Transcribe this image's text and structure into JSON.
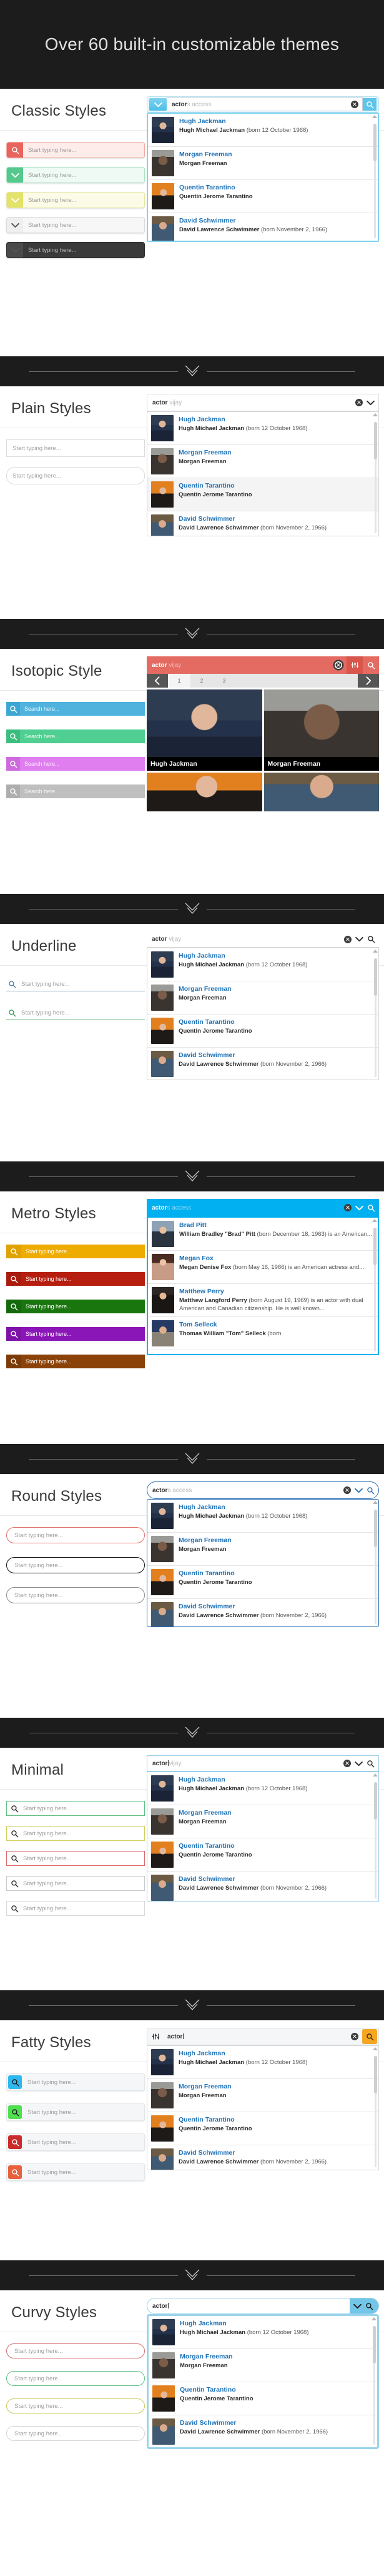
{
  "hero": {
    "title": "Over 60 built-in customizable themes"
  },
  "icons": {
    "clear": "clear-circle-icon",
    "search": "magnifier-icon",
    "chevron": "chevron-down-icon",
    "sliders": "sliders-icon",
    "prev": "chevron-left-icon",
    "next": "chevron-right-icon",
    "scroll_up": "scroll-up-arrow-icon"
  },
  "people": [
    {
      "name": "Hugh Jackman",
      "strong": "Hugh Michael Jackman",
      "rest": " (born 12 October 1968)"
    },
    {
      "name": "Morgan Freeman",
      "strong": "Morgan Freeman",
      "rest": ""
    },
    {
      "name": "Quentin Tarantino",
      "strong": "Quentin Jerome Tarantino",
      "rest": ""
    },
    {
      "name": "David Schwimmer",
      "strong": "David Lawrence Schwimmer",
      "rest": " (born November 2, 1966)"
    }
  ],
  "metro_people": [
    {
      "name": "Brad Pitt",
      "strong": "William Bradley \"Brad\" Pitt",
      "rest": " (born December 18, 1963) is an American..."
    },
    {
      "name": "Megan Fox",
      "strong": "Megan Denise Fox",
      "rest": " (born May 16, 1986) is an American actress and..."
    },
    {
      "name": "Matthew Perry",
      "strong": "Matthew Langford Perry",
      "rest": " (born August 19, 1969) is an actor with dual American and Canadian citizenship. He is well known..."
    },
    {
      "name": "Tom Selleck",
      "strong": "Thomas William \"Tom\" Selleck",
      "rest": " (born"
    }
  ],
  "sections": [
    {
      "id": "classic",
      "title": "Classic Styles",
      "query_typed": "actor",
      "query_ghost": "s access",
      "fields": [
        {
          "placeholder": "Start typing here...",
          "color": "#e8645c",
          "icon": "magnifier-icon",
          "border": "#f1a9a4",
          "bg": "#fdecea"
        },
        {
          "placeholder": "Start typing here...",
          "color": "#55c98d",
          "icon": "chevron-down-icon",
          "border": "#a6e4c3",
          "bg": "#eefaf3"
        },
        {
          "placeholder": "Start typing here...",
          "color": "#e3e36a",
          "icon": "chevron-down-icon",
          "border": "#e4e4a3",
          "bg": "#fbfbe8"
        },
        {
          "placeholder": "Start typing here...",
          "color": "#efefef",
          "icon": "chevron-down-icon",
          "border": "#dadada",
          "bg": "#f7f7f7"
        },
        {
          "placeholder": "Start typing here...",
          "color": "#4a4a4a",
          "icon": "chevron-down-icon",
          "border": "#2b2b2b",
          "bg": "#3a3a3a"
        }
      ]
    },
    {
      "id": "plain",
      "title": "Plain Styles",
      "query_typed": "actor",
      "query_ghost": " vijay",
      "fields": [
        {
          "placeholder": "Start typing here...",
          "radius": "0px"
        },
        {
          "placeholder": "Start typing here...",
          "radius": "13px"
        }
      ]
    },
    {
      "id": "isotopic",
      "title": "Isotopic Style",
      "query_typed": "actor",
      "query_ghost": " vijay",
      "accent": "#e46b61",
      "pages": [
        "1",
        "2",
        "3"
      ],
      "active_page": "1",
      "fields": [
        {
          "placeholder": "Search here...",
          "bg": "#4fb3dd",
          "blk": "#3da7d4"
        },
        {
          "placeholder": "Search here...",
          "bg": "#4fcf91",
          "blk": "#3cbd7f"
        },
        {
          "placeholder": "Search here...",
          "bg": "#e07ef0",
          "blk": "#cf6ade"
        },
        {
          "placeholder": "Search here...",
          "bg": "#bfbfbf",
          "blk": "#aeaeae"
        }
      ]
    },
    {
      "id": "underline",
      "title": "Underline",
      "query_typed": "actor",
      "query_ghost": " vijay",
      "fields": [
        {
          "placeholder": "Start typing here...",
          "color": "#5b7fa6",
          "line": "#8fa9c4"
        },
        {
          "placeholder": "Start typing here...",
          "color": "#3f9e5e",
          "line": "#64b77e"
        }
      ]
    },
    {
      "id": "metro",
      "title": "Metro Styles",
      "query_typed": "actor",
      "query_ghost": "s access",
      "accent": "#00b0f0",
      "fields": [
        {
          "placeholder": "Start typing here...",
          "bg": "#eeab00",
          "blk": "#e0a200"
        },
        {
          "placeholder": "Start typing here...",
          "bg": "#b61f10",
          "blk": "#a81b0d"
        },
        {
          "placeholder": "Start typing here...",
          "bg": "#19760f",
          "blk": "#14690b"
        },
        {
          "placeholder": "Start typing here...",
          "bg": "#8b16b7",
          "blk": "#7e11a7"
        },
        {
          "placeholder": "Start typing here...",
          "bg": "#8a4208",
          "blk": "#7c3a06"
        }
      ]
    },
    {
      "id": "round",
      "title": "Round Styles",
      "query_typed": "actor",
      "query_ghost": "s access",
      "fields": [
        {
          "placeholder": "Start typing here...",
          "border": "#e06f6a"
        },
        {
          "placeholder": "Start typing here...",
          "border": "#111111"
        },
        {
          "placeholder": "Start typing here...",
          "border": "#8a8a8a"
        }
      ]
    },
    {
      "id": "minimal",
      "title": "Minimal",
      "query_typed": "actor",
      "query_ghost": "vijay",
      "fields": [
        {
          "placeholder": "Start typing here...",
          "border": "#5fbf83"
        },
        {
          "placeholder": "Start typing here...",
          "border": "#cfcf5e"
        },
        {
          "placeholder": "Start typing here...",
          "border": "#d86a6a"
        },
        {
          "placeholder": "Start typing here...",
          "border": "#c9c9c9"
        },
        {
          "placeholder": "Start typing here...",
          "border": "#d9d9d9"
        }
      ]
    },
    {
      "id": "fatty",
      "title": "Fatty Styles",
      "query_typed": "actor",
      "query_ghost": "",
      "accent": "#f5a623",
      "fields": [
        {
          "placeholder": "Start typing here...",
          "bg": "#2eb8f0"
        },
        {
          "placeholder": "Start typing here...",
          "bg": "#4ee04e"
        },
        {
          "placeholder": "Start typing here...",
          "bg": "#cc2b2b"
        },
        {
          "placeholder": "Start typing here...",
          "bg": "#e8603c"
        }
      ]
    },
    {
      "id": "curvy",
      "title": "Curvy Styles",
      "query_typed": "actor",
      "query_ghost": "",
      "accent": "#74c6e8",
      "fields": [
        {
          "placeholder": "Start typing here...",
          "border": "#d46a6a"
        },
        {
          "placeholder": "Start typing here...",
          "border": "#5fbf83"
        },
        {
          "placeholder": "Start typing here...",
          "border": "#c8c857"
        },
        {
          "placeholder": "Start typing here...",
          "border": "#d5d5d5"
        }
      ]
    }
  ]
}
